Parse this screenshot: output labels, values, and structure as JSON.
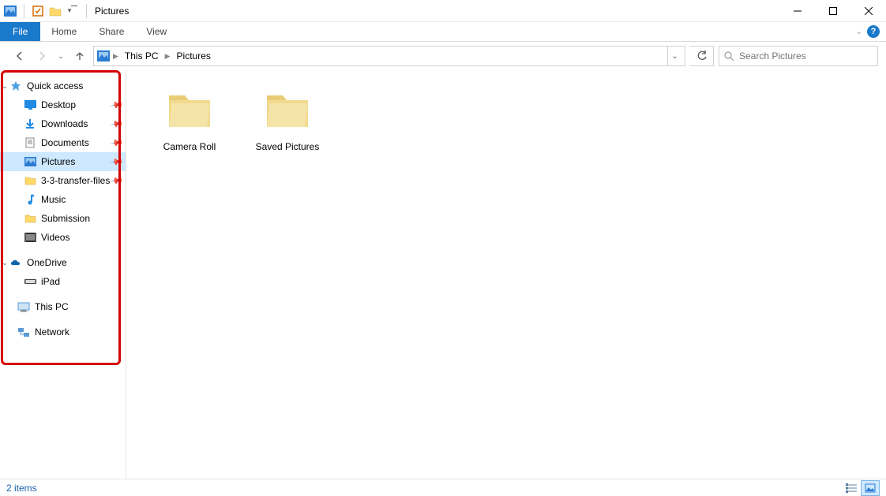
{
  "window": {
    "title": "Pictures"
  },
  "ribbon": {
    "file": "File",
    "tabs": [
      "Home",
      "Share",
      "View"
    ]
  },
  "breadcrumb": {
    "root": "This PC",
    "current": "Pictures"
  },
  "search": {
    "placeholder": "Search Pictures"
  },
  "nav": {
    "quick_access": {
      "label": "Quick access",
      "items": [
        {
          "label": "Desktop",
          "icon": "desktop",
          "pinned": true
        },
        {
          "label": "Downloads",
          "icon": "download",
          "pinned": true
        },
        {
          "label": "Documents",
          "icon": "document",
          "pinned": true
        },
        {
          "label": "Pictures",
          "icon": "pictures",
          "pinned": true,
          "selected": true
        },
        {
          "label": "3-3-transfer-files",
          "icon": "folder",
          "pinned": true
        },
        {
          "label": "Music",
          "icon": "music",
          "pinned": false
        },
        {
          "label": "Submission",
          "icon": "folder",
          "pinned": false
        },
        {
          "label": "Videos",
          "icon": "videos",
          "pinned": false
        }
      ]
    },
    "onedrive": {
      "label": "OneDrive",
      "items": [
        {
          "label": "iPad",
          "icon": "device"
        }
      ]
    },
    "thispc": {
      "label": "This PC"
    },
    "network": {
      "label": "Network"
    }
  },
  "content": {
    "folders": [
      {
        "label": "Camera Roll"
      },
      {
        "label": "Saved Pictures"
      }
    ]
  },
  "status": {
    "text": "2 items"
  },
  "colors": {
    "accent": "#1979ca",
    "highlight": "#cde8ff",
    "annotation": "#d40000"
  }
}
